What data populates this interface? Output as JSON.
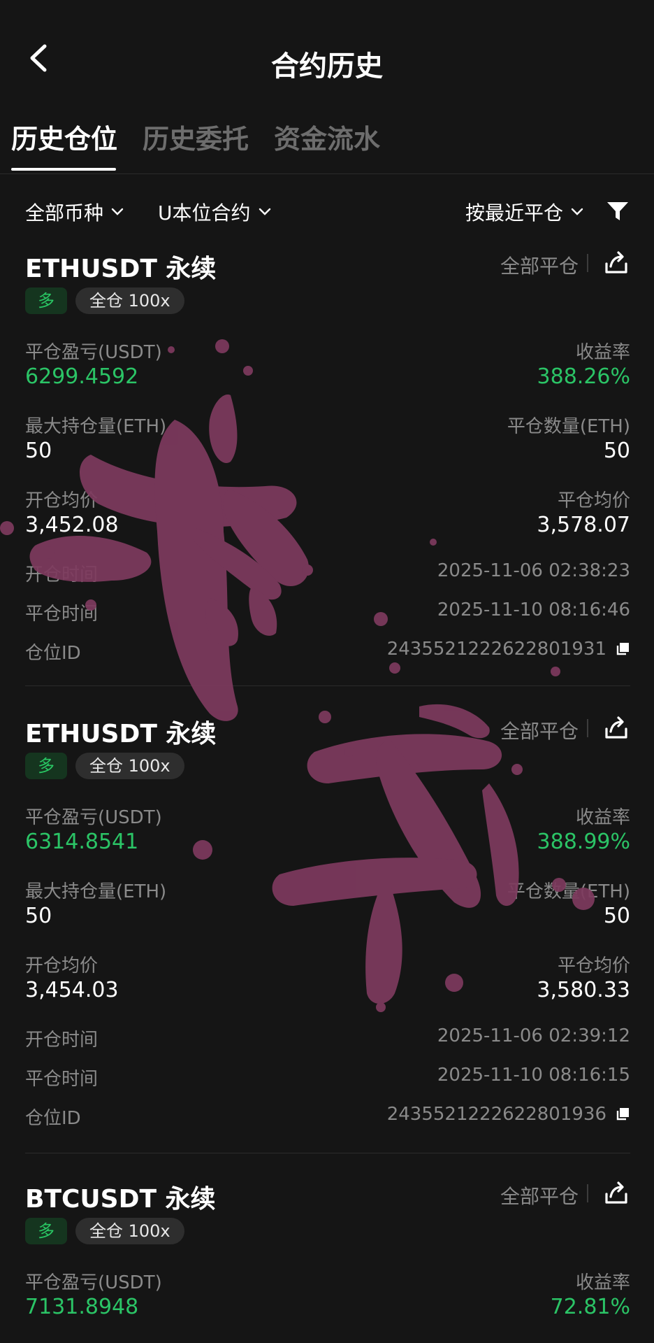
{
  "header": {
    "title": "合约历史"
  },
  "tabs": [
    {
      "label": "历史仓位"
    },
    {
      "label": "历史委托"
    },
    {
      "label": "资金流水"
    }
  ],
  "filters": {
    "coin": "全部币种",
    "contract": "U本位合约",
    "sort": "按最近平仓"
  },
  "labels": {
    "close_all": "全部平仓",
    "pnl": "平仓盈亏(USDT)",
    "roi": "收益率",
    "open_avg": "开仓均价",
    "close_avg": "平仓均价",
    "open_time": "开仓时间",
    "close_time": "平仓时间",
    "position_id": "仓位ID",
    "long": "多",
    "mode": "全仓 100x"
  },
  "positions": [
    {
      "symbol": "ETHUSDT 永续",
      "pnl": "6299.4592",
      "roi": "388.26%",
      "max_hold_label": "最大持仓量(ETH)",
      "max_hold": "50",
      "close_qty_label": "平仓数量(ETH)",
      "close_qty": "50",
      "open_avg": "3,452.08",
      "close_avg": "3,578.07",
      "open_time": "2025-11-06 02:38:23",
      "close_time": "2025-11-10 08:16:46",
      "position_id": "2435521222622801931"
    },
    {
      "symbol": "ETHUSDT 永续",
      "pnl": "6314.8541",
      "roi": "388.99%",
      "max_hold_label": "最大持仓量(ETH)",
      "max_hold": "50",
      "close_qty_label": "平仓数量(ETH)",
      "close_qty": "50",
      "open_avg": "3,454.03",
      "close_avg": "3,580.33",
      "open_time": "2025-11-06 02:39:12",
      "close_time": "2025-11-10 08:16:15",
      "position_id": "2435521222622801936"
    },
    {
      "symbol": "BTCUSDT 永续",
      "pnl": "7131.8948",
      "roi": "72.81%"
    }
  ],
  "colors": {
    "accent_green": "#2bc466",
    "overlay_ink": "#7e3a5e",
    "background": "#151515"
  },
  "icons": {
    "back": "chevron-left-icon",
    "share": "share-icon",
    "filter": "funnel-icon",
    "copy": "copy-icon"
  }
}
